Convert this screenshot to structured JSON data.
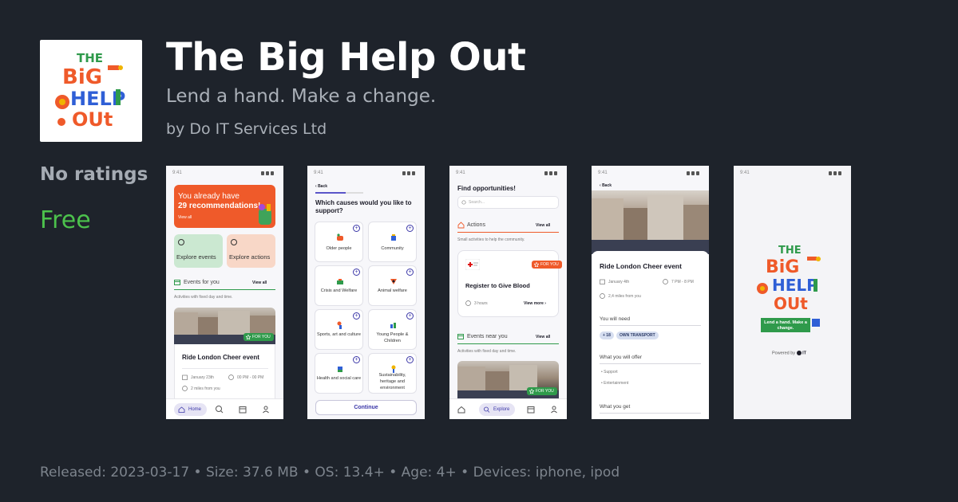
{
  "app": {
    "title": "The Big Help Out",
    "subtitle": "Lend a hand. Make a change.",
    "developer": "by Do IT Services Ltd",
    "ratings": "No ratings",
    "price": "Free",
    "icon_name": "the-big-help-out-logo",
    "icon_text": "THE BIG HELP OUT"
  },
  "footer": {
    "text": "Released: 2023-03-17 • Size: 37.6 MB • OS: 13.4+ • Age: 4+ • Devices: iphone, ipod"
  },
  "colors": {
    "background": "#1e232b",
    "price_green": "#4cc14c",
    "brand_orange": "#ef5a2a",
    "brand_blue": "#2f5fd6",
    "brand_green": "#2f9a4b",
    "accent_purple": "#3b37a8"
  },
  "screenshots": {
    "s1": {
      "time": "9:41",
      "banner_line1": "You already have",
      "banner_line2": "29 recommendations!",
      "banner_view_all": "View all",
      "explore_events": "Explore events",
      "explore_actions": "Explore actions",
      "section_title": "Events for you",
      "section_view_all": "View all",
      "section_sub": "Activities with fixed day and time.",
      "for_you": "FOR YOU",
      "event_title": "Ride London Cheer event",
      "event_date": "January 23th",
      "event_time": "00 PM - 00 PM",
      "event_distance": "2 miles from you",
      "tab_home": "Home"
    },
    "s2": {
      "time": "9:41",
      "back": "Back",
      "question": "Which causes would you like to support?",
      "causes": [
        "Older people",
        "Community",
        "Crisis and Welfare",
        "Animal welfare",
        "Sports, art and culture",
        "Young People & Children",
        "Health and social care",
        "Sustainability, heritage and environment"
      ],
      "continue": "Continue"
    },
    "s3": {
      "time": "9:41",
      "heading": "Find opportunities!",
      "search_placeholder": "Search...",
      "actions_title": "Actions",
      "actions_view_all": "View all",
      "actions_sub": "Small activities to help the community.",
      "for_you": "FOR YOU",
      "action_title": "Register to Give Blood",
      "action_duration": "3 hours",
      "action_more": "View more",
      "events_title": "Events near you",
      "events_view_all": "View all",
      "events_sub": "Activities with fixed day and time.",
      "events_for_you": "FOR YOU",
      "tab_explore": "Explore"
    },
    "s4": {
      "time": "9:41",
      "back": "Back",
      "title": "Ride London Cheer event",
      "date": "January 4th",
      "time_range": "7 PM - 8 PM",
      "distance": "2,4 miles from you",
      "need_title": "You will need",
      "need_tags": [
        "+ 18",
        "OWN TRANSPORT"
      ],
      "offer_title": "What you will offer",
      "offer_items": [
        "Support",
        "Entertainment"
      ],
      "get_title": "What you get"
    },
    "s5": {
      "time": "9:41",
      "logo_text": "THE BIG HELP OUT",
      "tagline": "Lend a hand. Make a change.",
      "powered_by": "Powered by",
      "powered_brand": "IT"
    }
  }
}
